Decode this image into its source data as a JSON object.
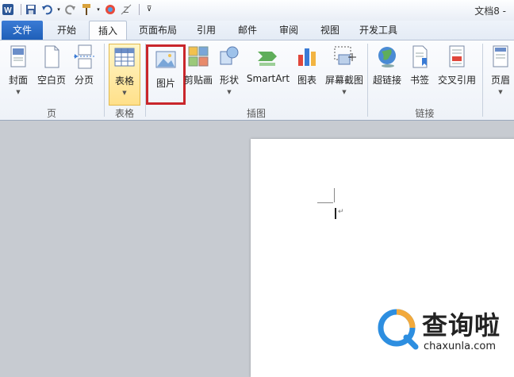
{
  "title_bar": {
    "doc_title": "文档8 -",
    "app_icon": "word-icon",
    "qat_icons": [
      "save-icon",
      "undo-icon",
      "redo-icon",
      "format-painter-icon",
      "color-icon",
      "clear-format-icon",
      "customize-icon"
    ]
  },
  "tabs": [
    {
      "label": "文件",
      "active": false
    },
    {
      "label": "开始",
      "active": false
    },
    {
      "label": "插入",
      "active": true
    },
    {
      "label": "页面布局",
      "active": false
    },
    {
      "label": "引用",
      "active": false
    },
    {
      "label": "邮件",
      "active": false
    },
    {
      "label": "审阅",
      "active": false
    },
    {
      "label": "视图",
      "active": false
    },
    {
      "label": "开发工具",
      "active": false
    }
  ],
  "ribbon": {
    "pages_group": {
      "label": "页",
      "buttons": [
        "封面",
        "空白页",
        "分页"
      ]
    },
    "table_group": {
      "label": "表格",
      "buttons": [
        "表格"
      ]
    },
    "illustrations_group": {
      "label": "插图",
      "buttons": [
        "图片",
        "剪贴画",
        "形状",
        "SmartArt",
        "图表",
        "屏幕截图"
      ]
    },
    "links_group": {
      "label": "链接",
      "buttons": [
        "超链接",
        "书签",
        "交叉引用"
      ]
    },
    "header_group": {
      "buttons": [
        "页眉"
      ]
    }
  },
  "highlight_color": "#c9262b",
  "document": {
    "paragraph_mark": "↵"
  },
  "watermark": {
    "title": "查询啦",
    "subtitle": "chaxunla.com"
  }
}
